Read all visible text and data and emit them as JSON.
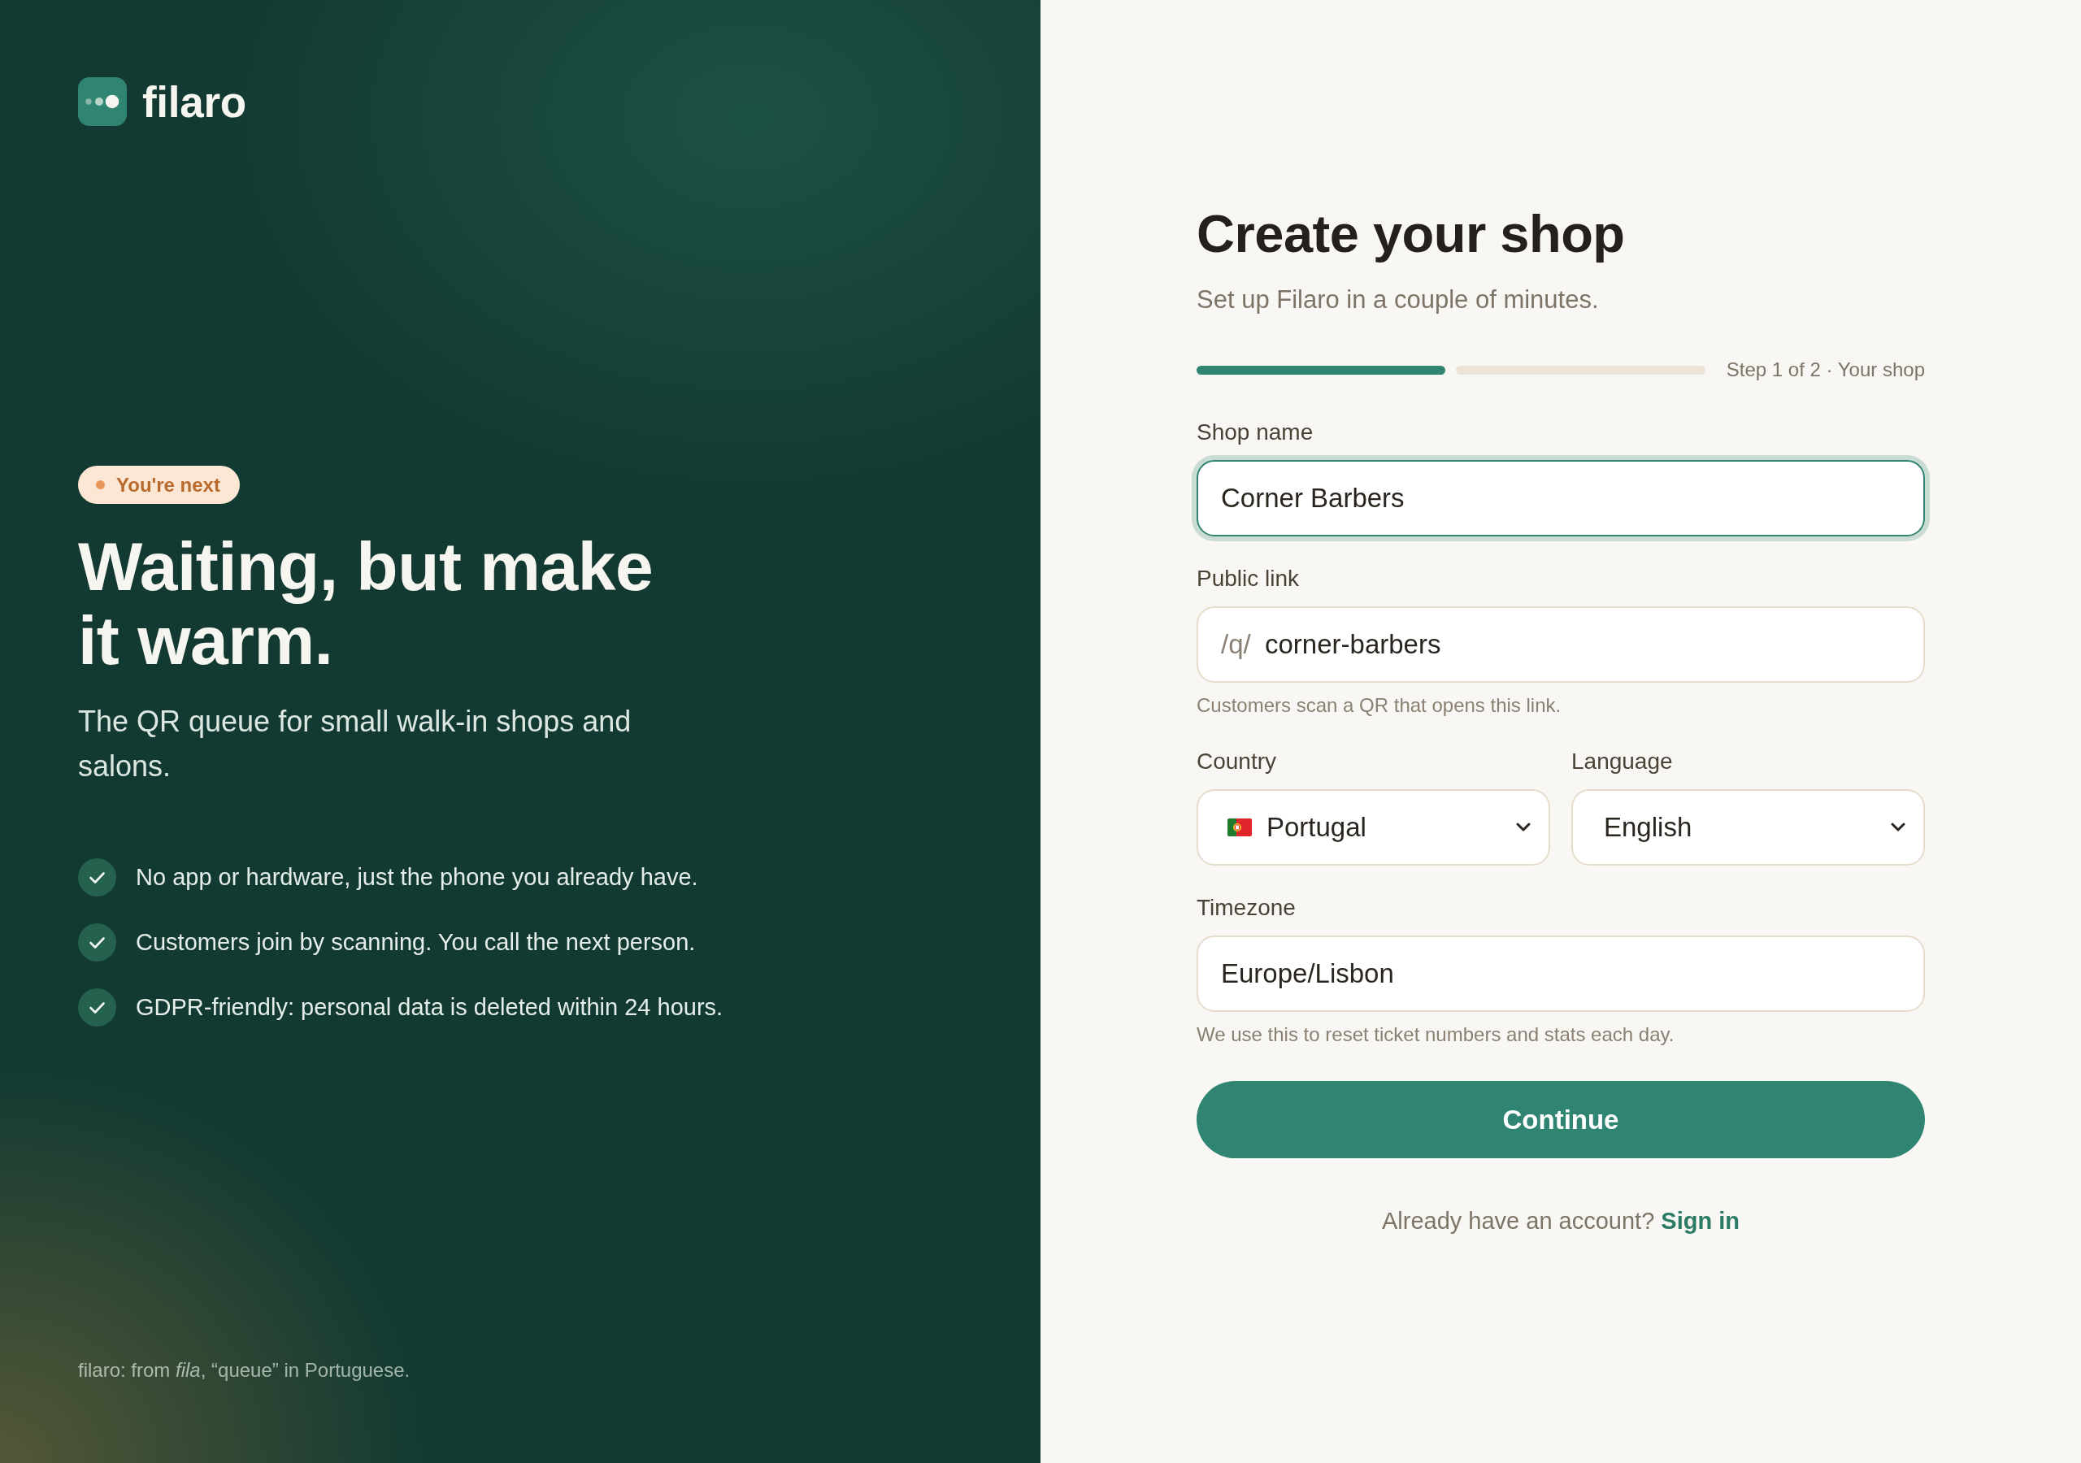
{
  "brand": {
    "name": "filaro"
  },
  "hero": {
    "badge": "You're next",
    "title": "Waiting, but make it warm.",
    "subtitle": "The QR queue for small walk-in shops and salons.",
    "features": [
      "No app or hardware, just the phone you already have.",
      "Customers join by scanning. You call the next person.",
      "GDPR-friendly: personal data is deleted within 24 hours."
    ],
    "footnote": "filaro: from *fila*, “queue” in Portuguese."
  },
  "form": {
    "title": "Create your shop",
    "subtitle": "Set up Filaro in a couple of minutes.",
    "progress": {
      "steps": [
        {
          "done": true
        },
        {
          "done": false
        }
      ],
      "label": "Step 1 of 2 · Your shop"
    },
    "shop_name": {
      "label": "Shop name",
      "value": "Corner Barbers",
      "focused": true
    },
    "public_link": {
      "label": "Public link",
      "prefix": "/q/",
      "value": "corner-barbers",
      "hint": "Customers scan a QR that opens this link.",
      "focused": false
    },
    "country": {
      "label": "Country",
      "value": "Portugal",
      "focused": false
    },
    "language": {
      "label": "Language",
      "value": "English",
      "focused": false
    },
    "timezone": {
      "label": "Timezone",
      "value": "Europe/Lisbon",
      "hint": "We use this to reset ticket numbers and stats each day.",
      "focused": false
    },
    "submit": "Continue",
    "signin": {
      "prompt": "Already have an account?",
      "link": "Sign in"
    }
  }
}
